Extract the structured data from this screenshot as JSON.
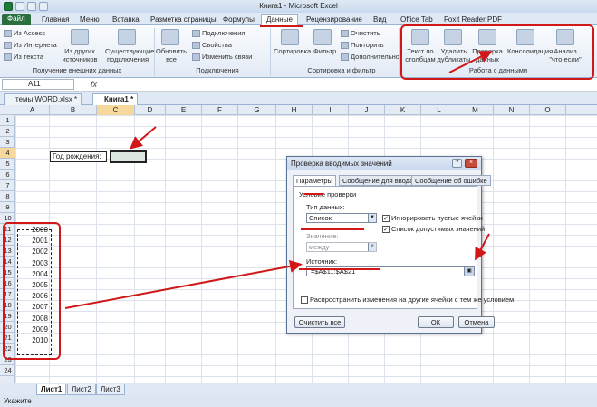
{
  "window": {
    "title": "Книга1 - Microsoft Excel"
  },
  "tabs": [
    "Файл",
    "Главная",
    "Меню",
    "Вставка",
    "Разметка страницы",
    "Формулы",
    "Данные",
    "Рецензирование",
    "Вид",
    "Office Tab",
    "Foxit Reader PDF"
  ],
  "ribbon": {
    "ext": {
      "access": "Из Access",
      "web": "Из Интернета",
      "text": "Из текста",
      "other": "Из других источников",
      "existing": "Существующие подключения",
      "group": "Получение внешних данных"
    },
    "conn": {
      "refresh": "Обновить все",
      "connections": "Подключения",
      "properties": "Свойства",
      "edit_links": "Изменить связи",
      "group": "Подключения"
    },
    "sort": {
      "sort": "Сортировка",
      "filter": "Фильтр",
      "clear": "Очистить",
      "reapply": "Повторить",
      "advanced": "Дополнительно",
      "group": "Сортировка и фильтр"
    },
    "tools": {
      "text_to_cols": "Текст по столбцам",
      "remove_dup": "Удалить дубликаты",
      "validation": "Проверка данных",
      "consolidate": "Консолидация",
      "whatif": "Анализ \"что если\"",
      "group": "Работа с данными"
    }
  },
  "namebox": "A11",
  "fx": "fx",
  "doctabs": [
    "темы WORD.xlsx *",
    "Книга1 *"
  ],
  "columns": [
    "A",
    "B",
    "C",
    "D",
    "E",
    "F",
    "G",
    "H",
    "I",
    "J",
    "K",
    "L",
    "M",
    "N",
    "O"
  ],
  "rows": [
    "1",
    "2",
    "3",
    "4",
    "5",
    "6",
    "7",
    "8",
    "9",
    "10",
    "11",
    "12",
    "13",
    "14",
    "15",
    "16",
    "17",
    "18",
    "19",
    "20",
    "21",
    "22",
    "23",
    "24"
  ],
  "cells": {
    "b4": "Год рождения:",
    "years": [
      "2000",
      "2001",
      "2002",
      "2003",
      "2004",
      "2005",
      "2006",
      "2007",
      "2008",
      "2009",
      "2010"
    ]
  },
  "sheets": [
    "Лист1",
    "Лист2",
    "Лист3"
  ],
  "status": "Укажите",
  "dialog": {
    "title": "Проверка вводимых значений",
    "tabs": [
      "Параметры",
      "Сообщение для ввода",
      "Сообщение об ошибке"
    ],
    "criteria": "Условие проверки",
    "type_label": "Тип данных:",
    "type_value": "Список",
    "ignore_blank": "Игнорировать пустые ячейки",
    "dropdown": "Список допустимых значений",
    "value_label": "Значение:",
    "value_value": "между",
    "source_label": "Источник:",
    "source_value": "=$A$11:$A$21",
    "apply_all": "Распространить изменения на другие ячейки с тем же условием",
    "clear_all": "Очистить все",
    "ok": "ОК",
    "cancel": "Отмена"
  },
  "colors": {
    "annotation": "#d01818",
    "file_tab": "#2a6f3d"
  }
}
